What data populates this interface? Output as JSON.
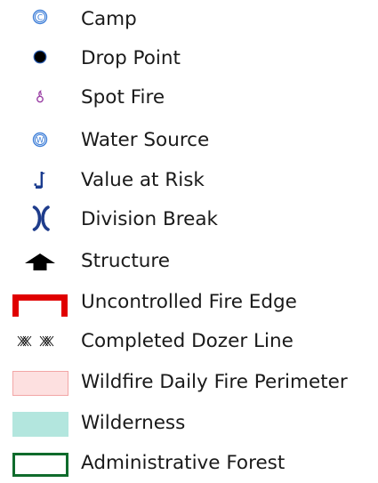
{
  "legend": {
    "items": [
      {
        "label": "Camp",
        "icon": "camp-icon"
      },
      {
        "label": "Drop Point",
        "icon": "drop-point-icon"
      },
      {
        "label": "Spot Fire",
        "icon": "spot-fire-icon"
      },
      {
        "label": "Water Source",
        "icon": "water-source-icon"
      },
      {
        "label": "Value at Risk",
        "icon": "value-at-risk-flag-icon"
      },
      {
        "label": "Division Break",
        "icon": "division-break-icon"
      },
      {
        "label": "Structure",
        "icon": "structure-icon"
      },
      {
        "label": "Uncontrolled Fire Edge",
        "icon": "uncontrolled-fire-edge-symbol"
      },
      {
        "label": "Completed Dozer Line",
        "icon": "completed-dozer-line-symbol"
      },
      {
        "label": "Wildfire Daily Fire Perimeter",
        "icon": "daily-fire-perimeter-swatch"
      },
      {
        "label": "Wilderness",
        "icon": "wilderness-swatch"
      },
      {
        "label": "Administrative Forest",
        "icon": "administrative-forest-swatch"
      }
    ],
    "symbol_text": {
      "camp": "C",
      "water": "W"
    },
    "colors": {
      "camp": "#3f7fd8",
      "drop_point_fill": "#000000",
      "drop_point_outline": "#2c5fb4",
      "spot_fire": "#9a3fa4",
      "water": "#3f7fd8",
      "value_flag": "#1b3c8f",
      "division_break": "#1f3d8c",
      "structure": "#000000",
      "fire_edge": "#e00000",
      "dozer_line": "#000000",
      "perimeter_fill": "#fde0e0",
      "perimeter_stroke": "#f2a6a6",
      "wilderness_fill": "#b3e6de",
      "forest_stroke": "#0f6b2c"
    }
  }
}
